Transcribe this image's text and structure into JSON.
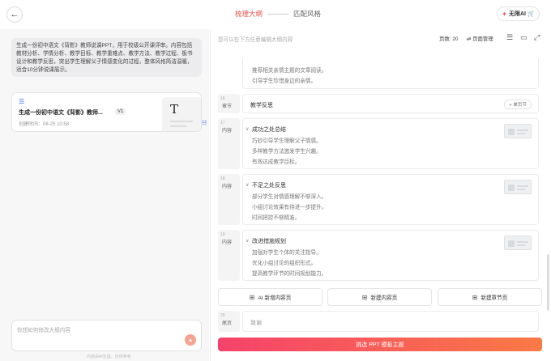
{
  "header": {
    "back_icon": "arrow-left-icon",
    "steps": [
      "梳理大纲",
      "匹配风格"
    ],
    "ai_button": "无限AI",
    "colors": {
      "accent": "#e8534a",
      "cta_start": "#f5426b",
      "cta_end": "#fa7a45"
    }
  },
  "left": {
    "prompt": "生成一份初中语文《背影》教师说课PPT，用于校级公开课评审。内容包括教材分析、学情分析、教学目标、教学重难点、教学方法、教学过程、板书设计和教学反思，突出学生理解父子情感变化的过程，整体风格简洁温暖，适合10分钟说课展示。",
    "doc": {
      "title": "生成一份初中语文《背影》教师...",
      "version": "V1",
      "time": "创建时间：08-25 10:58",
      "thumb_letter": "T"
    },
    "chat_placeholder": "你想如何修改大纲内容",
    "footer_note": "内容由AI生成，仅供参考"
  },
  "right": {
    "hint": "您可以在下方任意编辑大纲内容",
    "page_count": "页数: 20",
    "page_manage": "页面管理",
    "rows": [
      {
        "lines": [
          "推荐相关亲情主题的文章阅读。",
          "引导学生珍惜身边的亲情。"
        ]
      },
      {
        "num": "16",
        "tag": "章节",
        "title": "教学反思",
        "action": "单页节"
      },
      {
        "num": "17",
        "tag": "内容",
        "title": "成功之处总结",
        "lines": [
          "巧妙引导学生理解父子情感。",
          "多样教学方法激发学生兴趣。",
          "有效达成教学目标。"
        ]
      },
      {
        "num": "18",
        "tag": "内容",
        "title": "不足之处反思",
        "lines": [
          "部分学生对情感理解不够深入。",
          "小组讨论效果有待进一步提升。",
          "时间把控不够精准。"
        ]
      },
      {
        "num": "19",
        "tag": "内容",
        "title": "改进措施规划",
        "lines": [
          "加强对学生个体的关注指导。",
          "优化小组讨论的组织形式。",
          "提高教学环节的时间规划能力。"
        ]
      }
    ],
    "add_buttons": [
      "AI 新增内容页",
      "新建内容页",
      "新建章节页"
    ],
    "end_row": {
      "num": "20",
      "tag": "尾页",
      "text": "致谢"
    },
    "cta": "挑选 PPT 模板主题"
  }
}
